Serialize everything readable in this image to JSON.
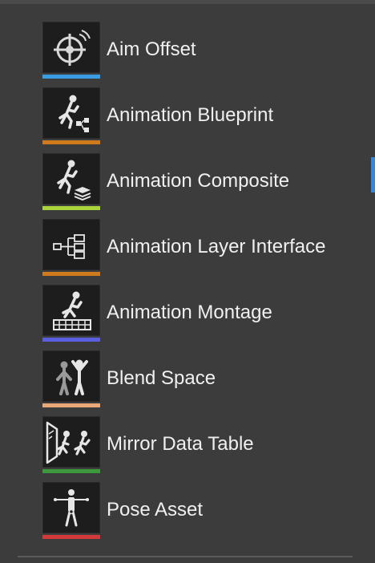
{
  "menu": {
    "accent_color": "#2e88e8",
    "items": [
      {
        "label": "Aim Offset",
        "icon": "aim-offset-icon",
        "bar_color": "#3a9de4"
      },
      {
        "label": "Animation Blueprint",
        "icon": "animation-blueprint-icon",
        "bar_color": "#d07a1e"
      },
      {
        "label": "Animation Composite",
        "icon": "animation-composite-icon",
        "bar_color": "#a8d43a"
      },
      {
        "label": "Animation Layer Interface",
        "icon": "animation-layer-interface-icon",
        "bar_color": "#d07a1e"
      },
      {
        "label": "Animation Montage",
        "icon": "animation-montage-icon",
        "bar_color": "#5a5ee0"
      },
      {
        "label": "Blend Space",
        "icon": "blend-space-icon",
        "bar_color": "#e8a878"
      },
      {
        "label": "Mirror Data Table",
        "icon": "mirror-data-table-icon",
        "bar_color": "#3c9a3c"
      },
      {
        "label": "Pose Asset",
        "icon": "pose-asset-icon",
        "bar_color": "#d23a3a"
      }
    ]
  }
}
